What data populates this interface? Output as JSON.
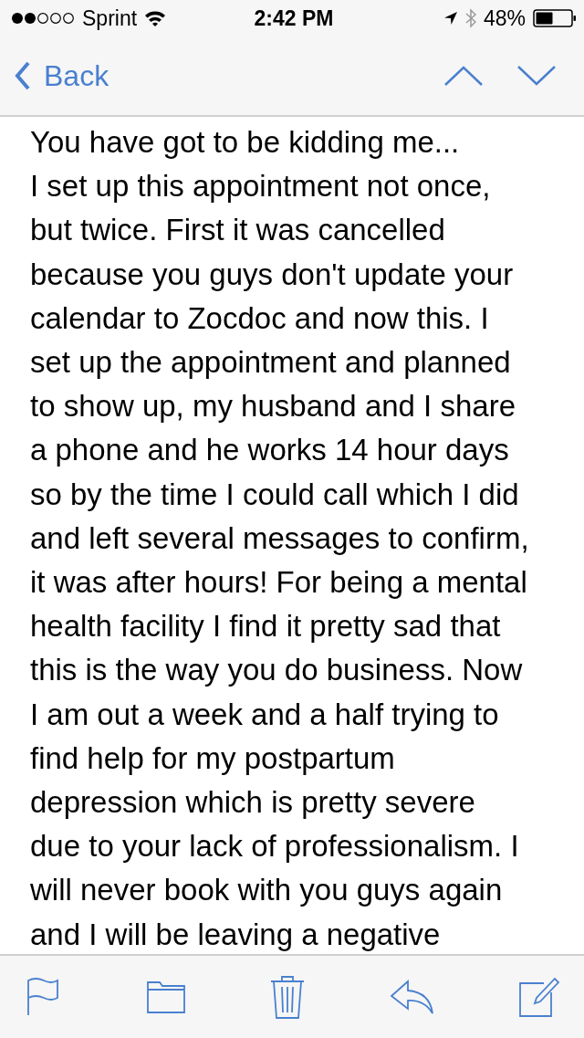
{
  "status_bar": {
    "carrier": "Sprint",
    "time": "2:42 PM",
    "battery": "48%"
  },
  "nav_bar": {
    "back": "Back"
  },
  "message": {
    "lines": [
      "You have got to be kidding me...",
      "I set up this appointment not once,",
      "but twice. First it was cancelled",
      "because you guys don't update your",
      "calendar to Zocdoc and now this. I",
      "set up the appointment and planned",
      "to show up, my husband and I share",
      "a phone and he works 14 hour days",
      "so by the time I could call which I did",
      "and left several messages to confirm,",
      "it was after hours! For being a mental",
      "health facility I find it pretty sad that",
      "this is the way you do business. Now",
      "I am out a week and a half trying to",
      "find help for my postpartum",
      "depression which is pretty severe",
      "due to your lack of professionalism. I",
      "will never book with you guys again",
      "and I will be leaving a negative"
    ]
  },
  "toolbar": {
    "items": [
      {
        "kind": "flag"
      },
      {
        "kind": "folder"
      },
      {
        "kind": "trash"
      },
      {
        "kind": "reply"
      },
      {
        "kind": "compose"
      }
    ]
  }
}
